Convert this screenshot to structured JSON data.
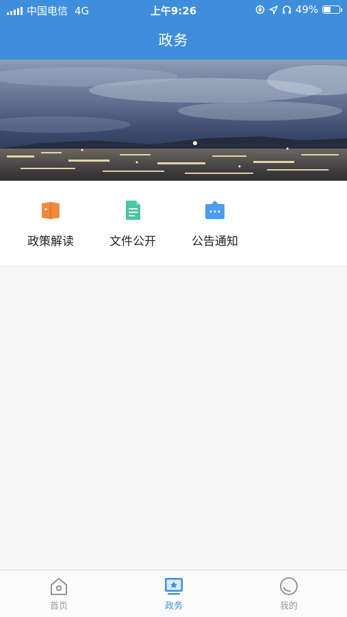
{
  "status_bar": {
    "carrier": "中国电信",
    "network": "4G",
    "time": "上午9:26",
    "battery_text": "49%",
    "battery_level": 0.49
  },
  "header": {
    "title": "政务"
  },
  "menu": {
    "items": [
      {
        "label": "政策解读",
        "icon": "book-icon",
        "color": "#ee8a3c"
      },
      {
        "label": "文件公开",
        "icon": "document-icon",
        "color": "#4cc4a2"
      },
      {
        "label": "公告通知",
        "icon": "message-icon",
        "color": "#4a9df0"
      }
    ]
  },
  "tabbar": {
    "tabs": [
      {
        "label": "首页",
        "icon": "home-icon",
        "active": false
      },
      {
        "label": "政务",
        "icon": "government-icon",
        "active": true
      },
      {
        "label": "我的",
        "icon": "profile-icon",
        "active": false
      }
    ],
    "active_color": "#3f8edb",
    "inactive_color": "#999999"
  },
  "colors": {
    "header_bg": "#3f8edb",
    "page_bg": "#f7f7f7"
  }
}
